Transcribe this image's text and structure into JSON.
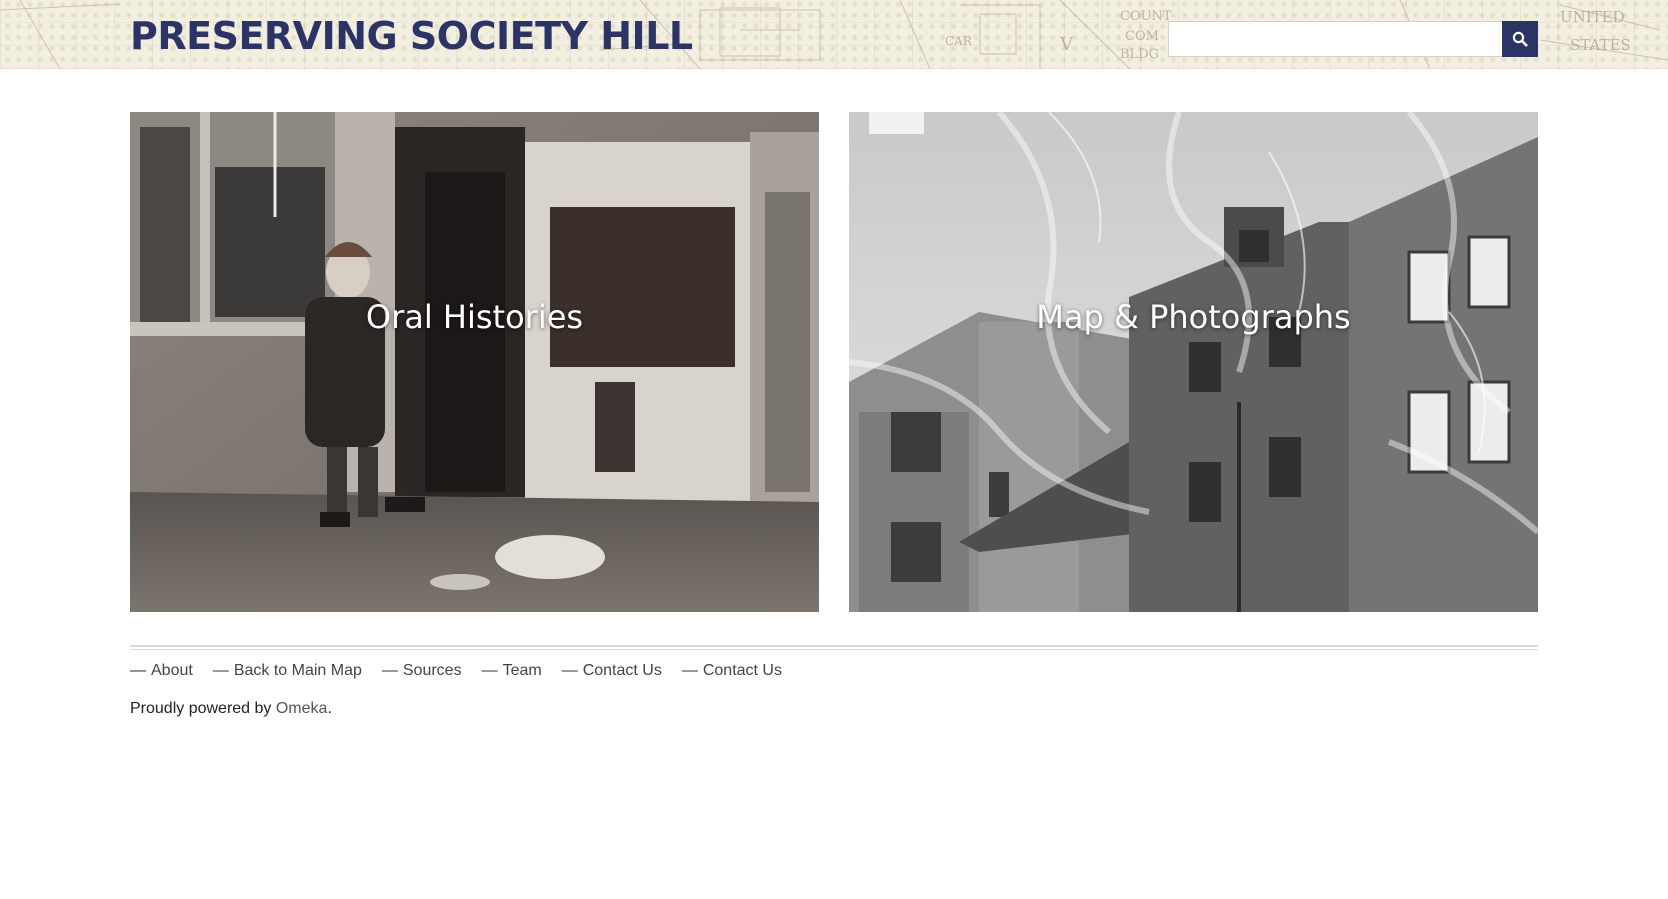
{
  "header": {
    "site_title": "PRESERVING SOCIETY HILL",
    "search": {
      "value": "",
      "placeholder": "",
      "button_icon": "search-icon"
    }
  },
  "tiles": [
    {
      "label": "Oral Histories"
    },
    {
      "label": "Map & Photographs"
    }
  ],
  "footer": {
    "nav": [
      {
        "label": "About"
      },
      {
        "label": "Back to Main Map"
      },
      {
        "label": "Sources"
      },
      {
        "label": "Team"
      },
      {
        "label": "Contact Us"
      },
      {
        "label": "Contact Us"
      }
    ],
    "powered_prefix": "Proudly powered by ",
    "powered_link": "Omeka",
    "powered_suffix": "."
  },
  "colors": {
    "brand": "#2b3464",
    "header_bg": "#f3efe0"
  }
}
